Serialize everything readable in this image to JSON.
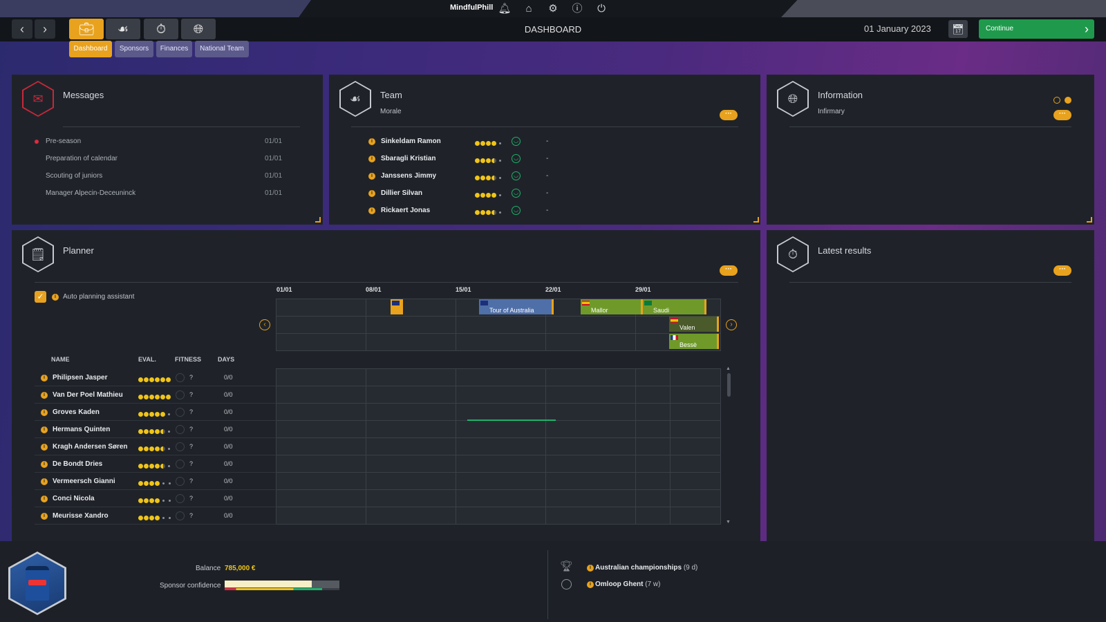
{
  "topbar": {
    "username": "MindfulPhill",
    "icons": [
      "bell-icon",
      "home-icon",
      "gear-icon",
      "info-icon",
      "power-icon"
    ]
  },
  "nav": {
    "page_title": "DASHBOARD",
    "date": "01 January 2023",
    "continue_label": "Continue",
    "back": "‹",
    "forward": "›"
  },
  "subtabs": [
    "Dashboard",
    "Sponsors",
    "Finances",
    "National Team"
  ],
  "messages": {
    "title": "Messages",
    "items": [
      {
        "text": "Pre-season",
        "date": "01/01",
        "unread": true
      },
      {
        "text": "Preparation of calendar",
        "date": "01/01",
        "unread": false
      },
      {
        "text": "Scouting of juniors",
        "date": "01/01",
        "unread": false
      },
      {
        "text": "Manager Alpecin-Deceuninck",
        "date": "01/01",
        "unread": false
      }
    ]
  },
  "team": {
    "title": "Team",
    "subtitle": "Morale",
    "more": "···",
    "riders": [
      {
        "name": "Sinkeldam Ramon",
        "rating": 4,
        "value": "-"
      },
      {
        "name": "Sbaragli Kristian",
        "rating": 3.5,
        "value": "-"
      },
      {
        "name": "Janssens Jimmy",
        "rating": 3.5,
        "value": "-"
      },
      {
        "name": "Dillier Silvan",
        "rating": 4,
        "value": "-"
      },
      {
        "name": "Rickaert Jonas",
        "rating": 3.5,
        "value": "-"
      }
    ]
  },
  "information": {
    "title": "Information",
    "subtitle": "Infirmary",
    "more": "···"
  },
  "planner": {
    "title": "Planner",
    "more": "···",
    "auto_label": "Auto planning assistant",
    "dates": [
      "01/01",
      "08/01",
      "15/01",
      "22/01",
      "29/01"
    ],
    "races": [
      {
        "name": "",
        "color": "#e8a21e",
        "flag": "AU"
      },
      {
        "name": "Tour of Australia",
        "color": "#4f6fa8",
        "flag": "AU"
      },
      {
        "name": "Mallor",
        "color": "#6f9a2a",
        "flag": "ES"
      },
      {
        "name": "Saudi",
        "color": "#6f9a2a",
        "flag": "SA"
      },
      {
        "name": "Valen",
        "color": "#4a5a2a",
        "flag": "ES"
      },
      {
        "name": "Bessè",
        "color": "#6f9a2a",
        "flag": "FR"
      }
    ],
    "columns": {
      "name": "NAME",
      "eval": "EVAL.",
      "fitness": "FITNESS",
      "days": "DAYS"
    },
    "riders": [
      {
        "name": "Philipsen Jasper",
        "rating": 6,
        "fitness": "?",
        "days": "0/0"
      },
      {
        "name": "Van Der Poel Mathieu",
        "rating": 6,
        "fitness": "?",
        "days": "0/0"
      },
      {
        "name": "Groves Kaden",
        "rating": 5,
        "fitness": "?",
        "days": "0/0"
      },
      {
        "name": "Hermans Quinten",
        "rating": 4.5,
        "fitness": "?",
        "days": "0/0"
      },
      {
        "name": "Kragh Andersen Søren",
        "rating": 4.5,
        "fitness": "?",
        "days": "0/0"
      },
      {
        "name": "De Bondt Dries",
        "rating": 4.5,
        "fitness": "?",
        "days": "0/0"
      },
      {
        "name": "Vermeersch Gianni",
        "rating": 4,
        "fitness": "?",
        "days": "0/0"
      },
      {
        "name": "Conci Nicola",
        "rating": 4,
        "fitness": "?",
        "days": "0/0"
      },
      {
        "name": "Meurisse Xandro",
        "rating": 4,
        "fitness": "?",
        "days": "0/0"
      }
    ]
  },
  "latest_results": {
    "title": "Latest results",
    "more": "···"
  },
  "finance": {
    "balance_label": "Balance",
    "balance": "785,000 €",
    "sponsor_label": "Sponsor confidence",
    "sponsor_confidence": 0.76
  },
  "upcoming": [
    {
      "name": "Australian championships",
      "when": "(9 d)",
      "icon": "trophy-icon"
    },
    {
      "name": "Omloop Ghent",
      "when": "(7 w)",
      "icon": "target-icon"
    }
  ],
  "colors": {
    "accent": "#e8a21e",
    "continue": "#1f9a4c",
    "unread": "#e0293f"
  }
}
